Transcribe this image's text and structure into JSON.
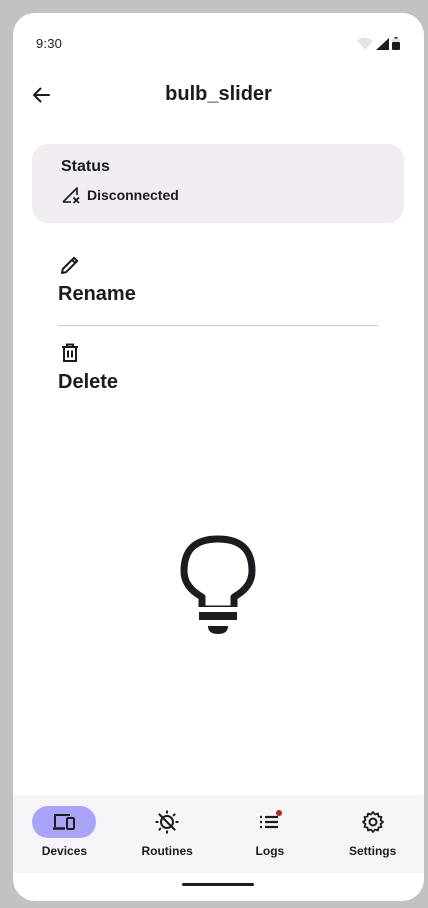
{
  "status_bar": {
    "time": "9:30"
  },
  "appbar": {
    "title": "bulb_slider"
  },
  "status_card": {
    "heading": "Status",
    "state": "Disconnected"
  },
  "actions": {
    "rename_label": "Rename",
    "delete_label": "Delete"
  },
  "device_icon": "lightbulb-icon",
  "bottom_nav": {
    "items": [
      {
        "label": "Devices",
        "icon": "devices-icon",
        "active": true
      },
      {
        "label": "Routines",
        "icon": "routines-icon",
        "active": false
      },
      {
        "label": "Logs",
        "icon": "logs-icon",
        "active": false,
        "badge": true
      },
      {
        "label": "Settings",
        "icon": "gear-icon",
        "active": false
      }
    ]
  },
  "colors": {
    "accent_pill": "#a9a4f7",
    "card_bg": "#f0ecf1",
    "badge": "#b3261e",
    "text": "#1c1b1f"
  }
}
